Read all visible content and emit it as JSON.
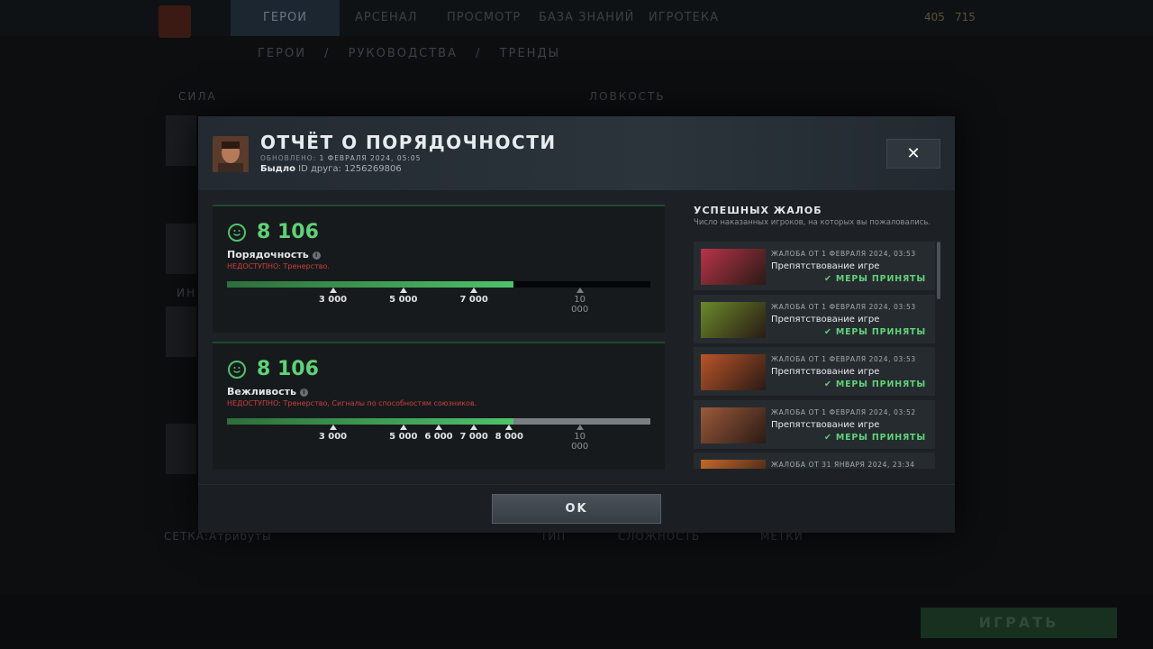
{
  "topnav": {
    "items": [
      "ГЕРОИ",
      "АРСЕНАЛ",
      "ПРОСМОТР",
      "БАЗА ЗНАНИЙ",
      "ИГРОТЕКА"
    ],
    "currency_1": "405",
    "currency_2": "715"
  },
  "subnav": {
    "items": [
      "ГЕРОИ",
      "/",
      "РУКОВОДСТВА",
      "/",
      "ТРЕНДЫ"
    ]
  },
  "background": {
    "attr_strength": "СИЛА",
    "attr_agility": "ЛОВКОСТЬ",
    "attr_int": "ИН",
    "grid_label": "СЕТКА:",
    "grid_value": "Атрибуты",
    "type_label": "ТИП",
    "complexity_label": "СЛОЖНОСТЬ",
    "tags_label": "МЕТКИ",
    "play_button": "ИГРАТЬ"
  },
  "modal": {
    "title": "ОТЧЁТ О ПОРЯДОЧНОСТИ",
    "updated_label": "ОБНОВЛЕНО:",
    "updated_value": "1 ФЕВРАЛЯ 2024, 05:05",
    "username": "Быдло",
    "friend_id_label": "ID друга:",
    "friend_id": "1256269806",
    "close_glyph": "✕",
    "ok_button": "OK"
  },
  "conduct": {
    "score": "8 106",
    "label": "Порядочность",
    "unavailable_label": "НЕДОСТУПНО:",
    "unavailable_text": "Тренерство.",
    "progress_fraction": 0.676,
    "ticks": [
      "3 000",
      "5 000",
      "7 000",
      "10 000"
    ],
    "tick_values": [
      3000,
      5000,
      7000,
      10000
    ],
    "dim_ticks": [
      "10 000"
    ]
  },
  "courtesy": {
    "score": "8 106",
    "label": "Вежливость",
    "unavailable_label": "НЕДОСТУПНО:",
    "unavailable_text": "Тренерство, Сигналы по способностям союзников.",
    "progress_fraction": 0.676,
    "ticks": [
      "3 000",
      "5 000",
      "6 000",
      "7 000",
      "8 000",
      "10 000"
    ],
    "tick_values": [
      3000,
      5000,
      6000,
      7000,
      8000,
      10000
    ],
    "dim_ticks": [
      "10 000"
    ]
  },
  "reports_panel": {
    "title": "УСПЕШНЫХ ЖАЛОБ",
    "subtitle": "Число наказанных игроков, на которых вы пожаловались.",
    "reports": [
      {
        "date": "ЖАЛОБА ОТ 1 ФЕВРАЛЯ 2024, 03:53",
        "reason": "Препятствование игре",
        "status": "МЕРЫ ПРИНЯТЫ",
        "color": "#b8334a"
      },
      {
        "date": "ЖАЛОБА ОТ 1 ФЕВРАЛЯ 2024, 03:53",
        "reason": "Препятствование игре",
        "status": "МЕРЫ ПРИНЯТЫ",
        "color": "#6a8a2a"
      },
      {
        "date": "ЖАЛОБА ОТ 1 ФЕВРАЛЯ 2024, 03:53",
        "reason": "Препятствование игре",
        "status": "МЕРЫ ПРИНЯТЫ",
        "color": "#b8552a"
      },
      {
        "date": "ЖАЛОБА ОТ 1 ФЕВРАЛЯ 2024, 03:52",
        "reason": "Препятствование игре",
        "status": "МЕРЫ ПРИНЯТЫ",
        "color": "#9a5a3a"
      },
      {
        "date": "ЖАЛОБА ОТ 31 ЯНВАРЯ 2024, 23:34",
        "reason": "",
        "status": "",
        "color": "#c4682a"
      }
    ]
  },
  "colors": {
    "accent_green": "#5fd277",
    "warning_red": "#c9403a"
  }
}
